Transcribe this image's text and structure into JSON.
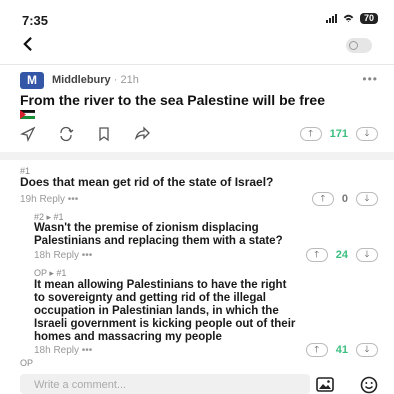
{
  "status": {
    "time": "7:35",
    "battery": "70"
  },
  "post": {
    "avatar_letter": "M",
    "community": "Middlebury",
    "age": "· 21h",
    "text": "From the river to the sea Palestine will be free",
    "score": "171"
  },
  "comments": [
    {
      "tag": "#1",
      "text_lines": [
        "Does that mean get rid of the state of Israel?"
      ],
      "meta": "19h  Reply  •••",
      "score": "0",
      "score_color": "grey"
    },
    {
      "tag": "#2 ▸ #1",
      "text_lines": [
        "Wasn't the premise of zionism displacing",
        "Palestinians and replacing them with a state?"
      ],
      "meta": "18h  Reply  •••",
      "score": "24",
      "score_color": "green"
    },
    {
      "tag": "OP ▸ #1",
      "text_lines": [
        "It mean allowing Palestinians to have the right",
        "to sovereignty and getting rid of the illegal",
        "occupation in Palestinian lands, in which the",
        "Israeli government is kicking people out of their",
        "homes and massacring my people"
      ],
      "meta": "18h  Reply  •••",
      "score": "41",
      "score_color": "green"
    }
  ],
  "op_tag": "OP",
  "composer": {
    "placeholder": "Write a comment..."
  },
  "icons": {
    "back": "‹",
    "more": "•••",
    "up": "🡑",
    "down": "🡓"
  }
}
